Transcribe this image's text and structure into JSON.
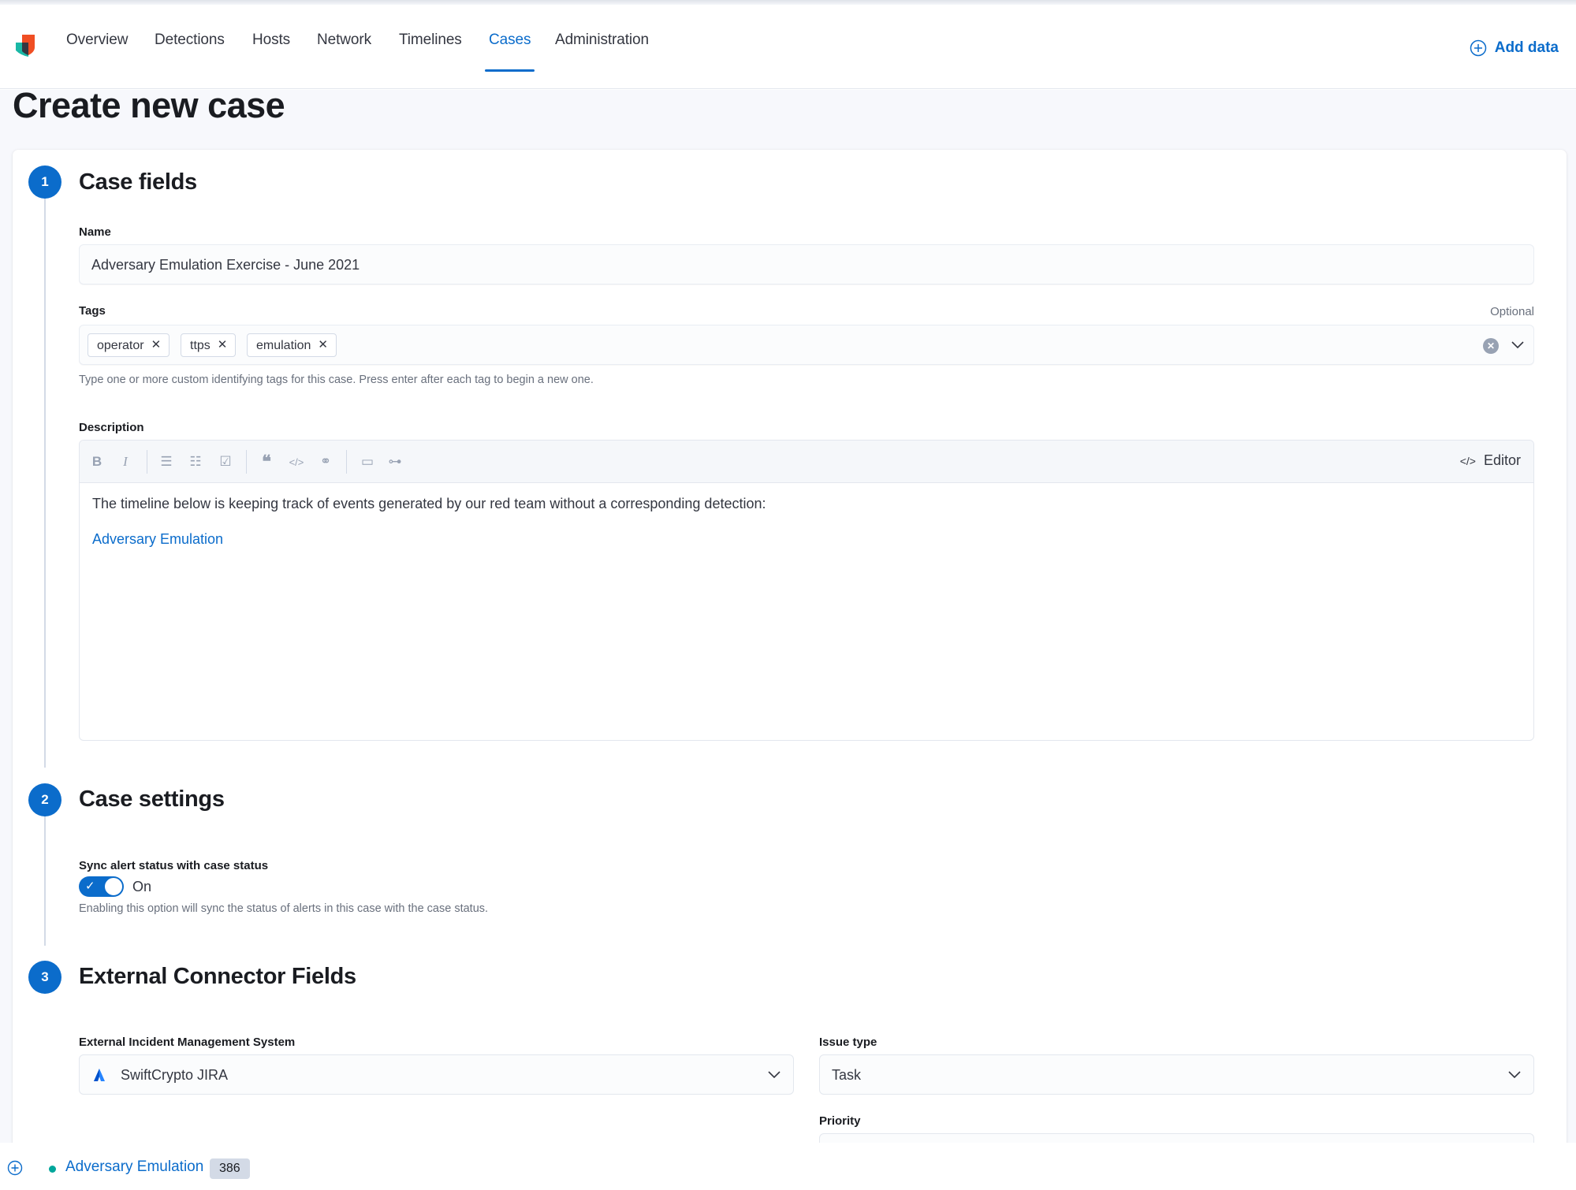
{
  "nav": {
    "items": [
      {
        "label": "Overview",
        "active": false
      },
      {
        "label": "Detections",
        "active": false
      },
      {
        "label": "Hosts",
        "active": false
      },
      {
        "label": "Network",
        "active": false
      },
      {
        "label": "Timelines",
        "active": false
      },
      {
        "label": "Cases",
        "active": true
      },
      {
        "label": "Administration",
        "active": false
      }
    ],
    "add_data_label": "Add data",
    "accent_color": "#0b6ccb"
  },
  "page": {
    "title": "Create new case"
  },
  "steps": [
    {
      "number": "1",
      "title": "Case fields"
    },
    {
      "number": "2",
      "title": "Case settings"
    },
    {
      "number": "3",
      "title": "External Connector Fields"
    }
  ],
  "case_fields": {
    "name": {
      "label": "Name",
      "value": "Adversary Emulation Exercise - June 2021"
    },
    "tags": {
      "label": "Tags",
      "optional_label": "Optional",
      "values": [
        "operator",
        "ttps",
        "emulation"
      ],
      "help": "Type one or more custom identifying tags for this case. Press enter after each tag to begin a new one."
    },
    "description": {
      "label": "Description",
      "toolbar": [
        {
          "icon": "bold-icon",
          "glyph": "B"
        },
        {
          "icon": "italic-icon",
          "glyph": "I"
        },
        {
          "icon": "bullet-list-icon",
          "glyph": "☰"
        },
        {
          "icon": "numbered-list-icon",
          "glyph": "☷"
        },
        {
          "icon": "checkbox-icon",
          "glyph": "☑"
        },
        {
          "icon": "quote-icon",
          "glyph": "❝"
        },
        {
          "icon": "code-icon",
          "glyph": "</>"
        },
        {
          "icon": "link-icon",
          "glyph": "⚭"
        },
        {
          "icon": "comment-icon",
          "glyph": "▭"
        },
        {
          "icon": "timeline-icon",
          "glyph": "⊶"
        }
      ],
      "editor_toggle_label": "Editor",
      "text": "The timeline below is keeping track of events generated by our red team without a corresponding detection:",
      "link_text": "Adversary Emulation"
    }
  },
  "case_settings": {
    "sync_label": "Sync alert status with case status",
    "toggle_on": true,
    "toggle_state_label": "On",
    "help": "Enabling this option will sync the status of alerts in this case with the case status."
  },
  "connector": {
    "system_label": "External Incident Management System",
    "system_value": "SwiftCrypto JIRA",
    "issue_type_label": "Issue type",
    "issue_type_value": "Task",
    "priority_label": "Priority"
  },
  "footer": {
    "timeline_name": "Adversary Emulation",
    "event_count": "386",
    "status_color": "#00a69b"
  }
}
